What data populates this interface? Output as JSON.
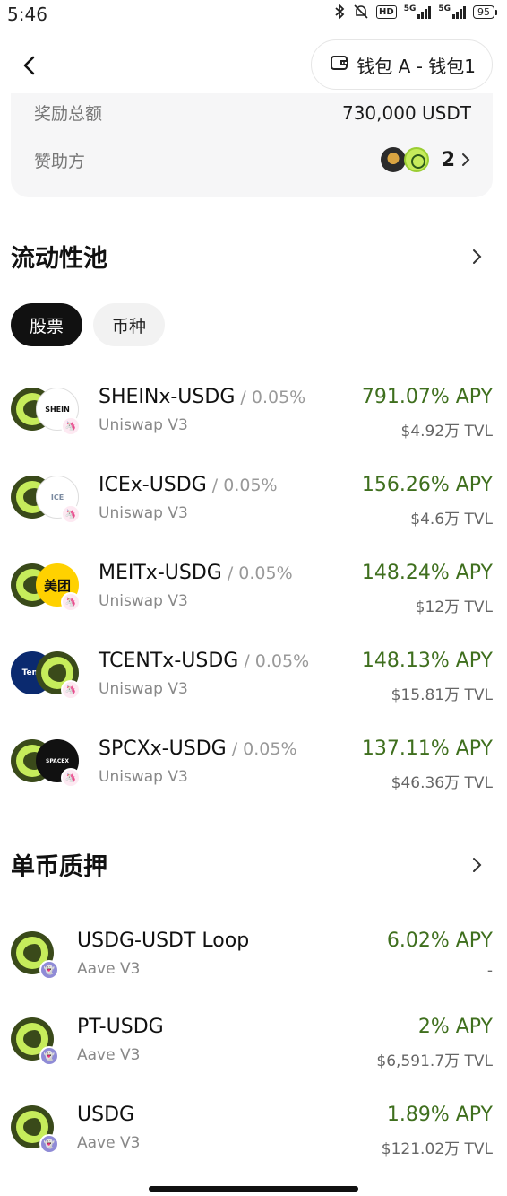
{
  "status": {
    "time": "5:46",
    "net1": "HD",
    "net2": "5G",
    "net3": "5G",
    "battery": "95"
  },
  "header": {
    "back_icon": "chevron-left-icon",
    "wallet_icon": "wallet-icon",
    "wallet_label": "钱包 A - 钱包1"
  },
  "reward": {
    "total_label": "奖励总额",
    "total_value": "730,000 USDT",
    "sponsor_label": "赞助方",
    "sponsor_count": "2"
  },
  "pools": {
    "title": "流动性池",
    "tabs": [
      "股票",
      "币种"
    ],
    "items": [
      {
        "name": "SHEINx-USDG",
        "fee": " / 0.05%",
        "protocol": "Uniswap V3",
        "apy": "791.07% APY",
        "tvl": "$4.92万 TVL",
        "logo_text": "SHEIN"
      },
      {
        "name": "ICEx-USDG",
        "fee": " / 0.05%",
        "protocol": "Uniswap V3",
        "apy": "156.26% APY",
        "tvl": "$4.6万 TVL",
        "logo_text": "ICE"
      },
      {
        "name": "MEITx-USDG",
        "fee": " / 0.05%",
        "protocol": "Uniswap V3",
        "apy": "148.24% APY",
        "tvl": "$12万 TVL",
        "logo_text": "美团"
      },
      {
        "name": "TCENTx-USDG",
        "fee": " / 0.05%",
        "protocol": "Uniswap V3",
        "apy": "148.13% APY",
        "tvl": "$15.81万 TVL",
        "logo_text": "Tenc"
      },
      {
        "name": "SPCXx-USDG",
        "fee": " / 0.05%",
        "protocol": "Uniswap V3",
        "apy": "137.11% APY",
        "tvl": "$46.36万 TVL",
        "logo_text": "SPACEX"
      }
    ]
  },
  "staking": {
    "title": "单币质押",
    "items": [
      {
        "name": "USDG-USDT Loop",
        "protocol": "Aave V3",
        "apy": "6.02% APY",
        "tvl": "-"
      },
      {
        "name": "PT-USDG",
        "protocol": "Aave V3",
        "apy": "2% APY",
        "tvl": "$6,591.7万 TVL"
      },
      {
        "name": "USDG",
        "protocol": "Aave V3",
        "apy": "1.89% APY",
        "tvl": "$121.02万 TVL"
      }
    ]
  },
  "colors": {
    "apy_green": "#3f6f1e",
    "usdg_lime": "#c6ec5b",
    "aave_purple": "#8f8bd6"
  }
}
